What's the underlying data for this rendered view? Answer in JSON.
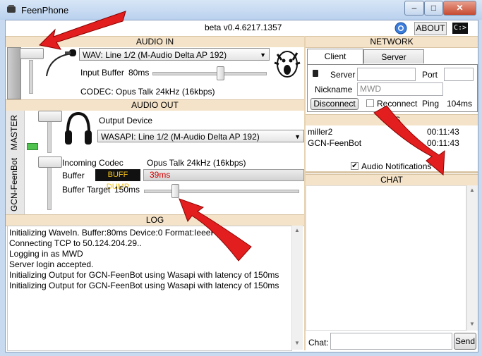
{
  "window": {
    "title": "FeenPhone",
    "minimize": "–",
    "maximize": "□",
    "close": "✕"
  },
  "topbar": {
    "version": "beta v0.4.6217.1357",
    "about": "ABOUT",
    "console": "C:>"
  },
  "audio_in": {
    "header": "AUDIO IN",
    "device": "WAV: Line 1/2 (M-Audio Delta AP 192)",
    "input_buffer_label": "Input Buffer",
    "input_buffer_value": "80ms",
    "input_buffer_level": 0.6,
    "codec": "CODEC:  Opus Talk 24kHz (16kbps)"
  },
  "audio_out": {
    "header": "AUDIO OUT",
    "master_label": "MASTER",
    "output_device_label": "Output Device",
    "output_device": "WASAPI: Line 1/2 (M-Audio Delta AP 192)",
    "user_label": "GCN-FeenBot",
    "incoming_codec_label": "Incoming Codec",
    "incoming_codec_value": "Opus Talk 24kHz (16kbps)",
    "buffer_label": "Buffer",
    "buff_dump": "BUFF DUMP",
    "buffer_value": "39ms",
    "buffer_target_label": "Buffer Target",
    "buffer_target_value": "150ms",
    "buffer_target_level": 0.2
  },
  "log": {
    "header": "LOG",
    "lines": [
      "Initializing WaveIn. Buffer:80ms Device:0 Format:IeeeFl",
      "Connecting TCP to 50.124.204.29..",
      "Logging in as MWD",
      "Server login accepted.",
      "Initializing Output for GCN-FeenBot using Wasapi with latency of 150ms",
      "Initializing Output for GCN-FeenBot using Wasapi with latency of 150ms"
    ]
  },
  "network": {
    "header": "NETWORK",
    "tabs": [
      "Client",
      "Server"
    ],
    "server_label": "Server",
    "server_value": "",
    "port_label": "Port",
    "port_value": "",
    "nickname_label": "Nickname",
    "nickname_value": "MWD",
    "disconnect": "Disconnect",
    "reconnect": "Reconnect",
    "ping_label": "Ping",
    "ping_value": "104ms"
  },
  "users": {
    "header": "ERS",
    "rows": [
      {
        "name": "miller2",
        "time": "00:11:43"
      },
      {
        "name": "GCN-FeenBot",
        "time": "00:11:43"
      }
    ],
    "audio_notifications": "Audio Notifications",
    "audio_notifications_checked": "✔"
  },
  "chat": {
    "header": "CHAT",
    "label": "Chat:",
    "input_value": "",
    "send": "Send"
  },
  "icons": {
    "app": "phone-icon",
    "chrome": "chrome-icon",
    "mic": "microphone-icon",
    "headphones": "headphones-icon",
    "nickname": "phone-small-icon"
  }
}
